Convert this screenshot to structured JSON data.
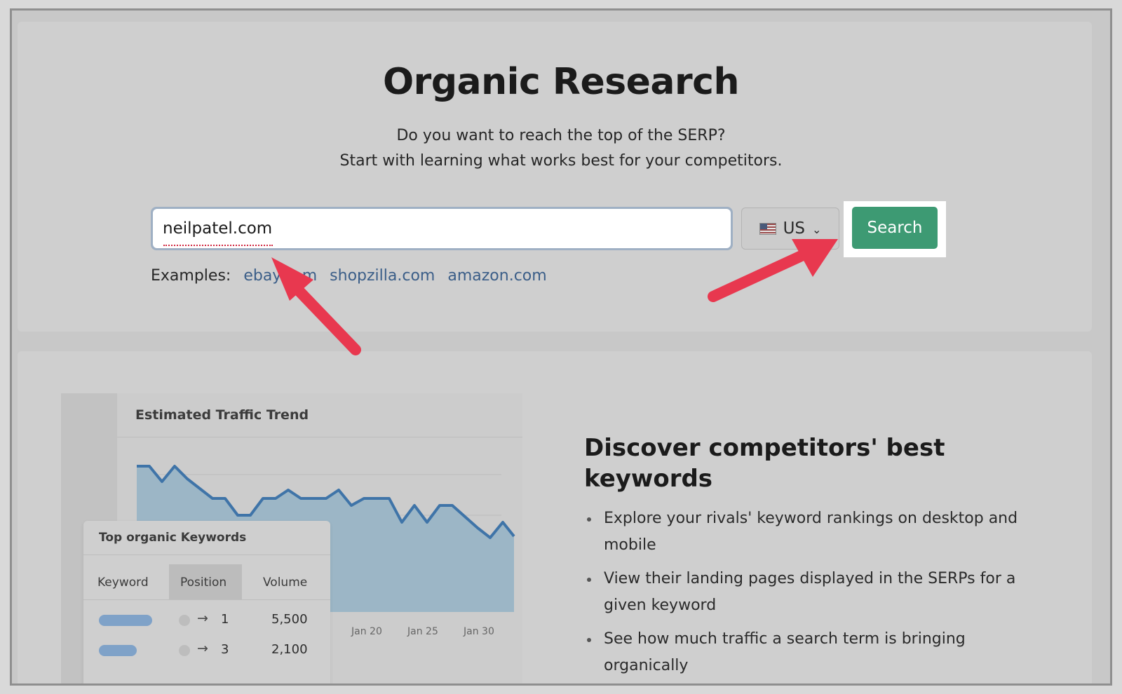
{
  "header": {
    "title": "Organic Research",
    "subtitle_line1": "Do you want to reach the top of the SERP?",
    "subtitle_line2": "Start with learning what works best for your competitors."
  },
  "search": {
    "value": "neilpatel.com",
    "country": "US",
    "button_label": "Search"
  },
  "examples": {
    "label": "Examples:",
    "links": [
      "ebay.com",
      "shopzilla.com",
      "amazon.com"
    ]
  },
  "traffic_chart": {
    "title": "Estimated Traffic Trend",
    "x_labels": [
      "Jan 20",
      "Jan 25",
      "Jan 30"
    ]
  },
  "keywords_card": {
    "title": "Top organic Keywords",
    "columns": [
      "Keyword",
      "Position",
      "Volume"
    ],
    "rows": [
      {
        "position": "1",
        "volume": "5,500"
      },
      {
        "position": "3",
        "volume": "2,100"
      }
    ]
  },
  "promo": {
    "title": "Discover competitors' best keywords",
    "bullets": [
      "Explore your rivals' keyword rankings on desktop and mobile",
      "View their landing pages displayed in the SERPs for a given keyword",
      "See how much traffic a search term is bringing organically"
    ]
  },
  "colors": {
    "search_button": "#3d9a73",
    "link": "#3b5e88",
    "arrow": "#e8384f",
    "chart_line": "#3f74a8"
  },
  "icons": [
    "us-flag-icon",
    "chevron-down-icon",
    "arrow-right-icon"
  ]
}
